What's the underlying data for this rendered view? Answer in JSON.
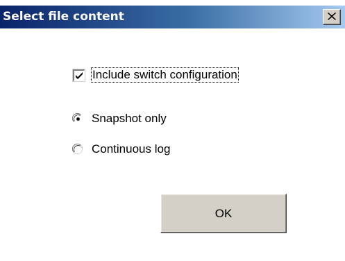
{
  "window": {
    "title": "Select file content",
    "close_glyph": "✕"
  },
  "options": {
    "include_switch_configuration": {
      "label": "Include switch configuration",
      "checked": true
    },
    "mode": {
      "selected": "Snapshot only",
      "choices": [
        {
          "label": "Snapshot only",
          "selected": true
        },
        {
          "label": "Continuous log",
          "selected": false
        }
      ]
    }
  },
  "buttons": {
    "ok_label": "OK"
  },
  "colors": {
    "title_bar_start": "#0a246a",
    "title_bar_end": "#a6caf0",
    "button_face": "#d4d0c8",
    "background": "#ffffff"
  }
}
